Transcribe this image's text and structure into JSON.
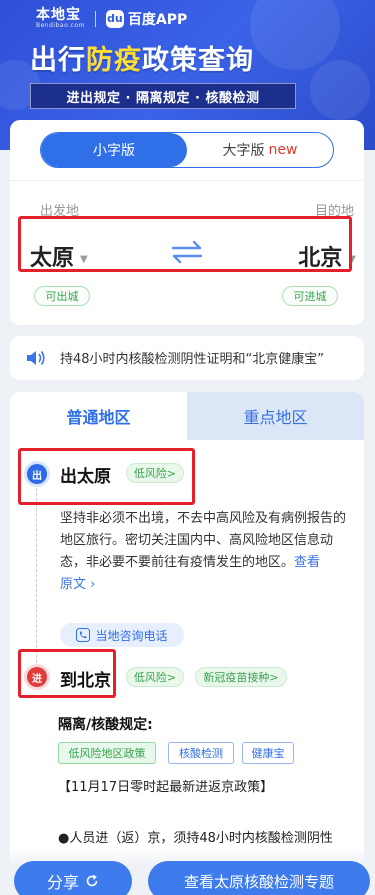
{
  "header": {
    "brand_bendi": "本地宝",
    "brand_bendi_sub": "Bendibao.com",
    "baidu_badge": "du",
    "baidu_app": "百度APP",
    "title_part1": "出行",
    "title_highlight": "防疫",
    "title_part2": "政策查询",
    "subtitle": "进出规定 · 隔离规定 · 核酸检测"
  },
  "mode_toggle": {
    "small_label": "小字版",
    "large_label": "大字版",
    "new_label": "new"
  },
  "route": {
    "from_label": "出发地",
    "to_label": "目的地",
    "from_city": "太原",
    "to_city": "北京",
    "from_status": "可出城",
    "to_status": "可进城"
  },
  "notice": {
    "text": "持48小时内核酸检测阴性证明和“北京健康宝”"
  },
  "tabs": {
    "normal": "普通地区",
    "key": "重点地区"
  },
  "departure": {
    "node": "出",
    "title": "出太原",
    "risk": "低风险>",
    "text": "坚持非必须不出境，不去中高风险及有病例报告的地区旅行。密切关注国内中、高风险地区信息动态，非必要不要前往有疫情发生的地区。",
    "link_see": "查看",
    "link_orig": "原文",
    "consult": "当地咨询电话"
  },
  "arrival": {
    "node": "进",
    "title": "到北京",
    "risk": "低风险>",
    "vaccine": "新冠疫苗接种>",
    "rules_heading": "隔离/核酸规定:",
    "tags": [
      "低风险地区政策",
      "核酸检测",
      "健康宝"
    ],
    "policy_date": "【11月17日零时起最新进返京政策】",
    "bullet": "●人员进（返）京，须持48小时内核酸检测阴性"
  },
  "bottom": {
    "share": "分享",
    "topic": "查看太原核酸检测专题"
  },
  "colors": {
    "primary": "#2f6fe8",
    "header": "#3a63e8",
    "highlight": "#ffdd33",
    "green": "#39a64d",
    "red_box": "#e5202a"
  }
}
